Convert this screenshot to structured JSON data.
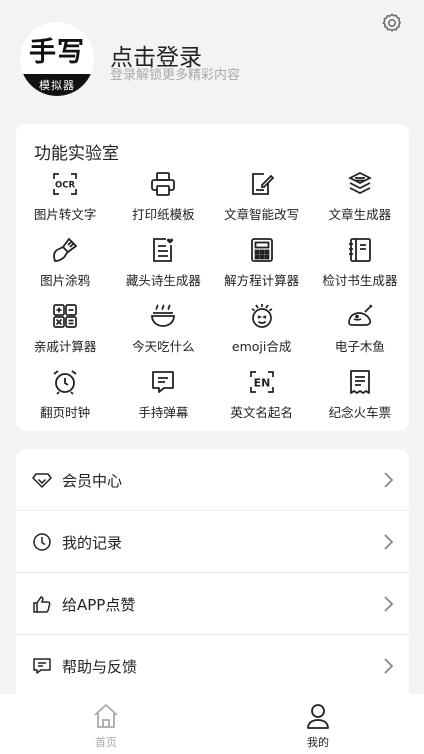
{
  "profile": {
    "logo_main": "手写",
    "logo_sub": "模拟器",
    "login_title": "点击登录",
    "login_subtitle": "登录解锁更多精彩内容"
  },
  "lab": {
    "title": "功能实验室",
    "tools": [
      {
        "label": "图片转文字",
        "icon": "ocr-icon"
      },
      {
        "label": "打印纸模板",
        "icon": "printer-icon"
      },
      {
        "label": "文章智能改写",
        "icon": "edit-doc-icon"
      },
      {
        "label": "文章生成器",
        "icon": "doc-stack-icon"
      },
      {
        "label": "图片涂鸦",
        "icon": "brush-icon"
      },
      {
        "label": "藏头诗生成器",
        "icon": "poem-doc-icon"
      },
      {
        "label": "解方程计算器",
        "icon": "calculator-icon"
      },
      {
        "label": "检讨书生成器",
        "icon": "notebook-icon"
      },
      {
        "label": "亲戚计算器",
        "icon": "relative-calc-icon"
      },
      {
        "label": "今天吃什么",
        "icon": "bowl-icon"
      },
      {
        "label": "emoji合成",
        "icon": "emoji-icon"
      },
      {
        "label": "电子木鱼",
        "icon": "wooden-fish-icon"
      },
      {
        "label": "翻页时钟",
        "icon": "alarm-clock-icon"
      },
      {
        "label": "手持弹幕",
        "icon": "chat-bubble-icon"
      },
      {
        "label": "英文名起名",
        "icon": "en-icon"
      },
      {
        "label": "纪念火车票",
        "icon": "ticket-icon"
      }
    ]
  },
  "menu": {
    "items": [
      {
        "label": "会员中心",
        "icon": "diamond-icon"
      },
      {
        "label": "我的记录",
        "icon": "clock-icon"
      },
      {
        "label": "给APP点赞",
        "icon": "thumbs-up-icon"
      },
      {
        "label": "帮助与反馈",
        "icon": "feedback-icon"
      }
    ]
  },
  "tabbar": {
    "home": "首页",
    "mine": "我的",
    "active_color": "#222222",
    "inactive_color": "#aaaaaa"
  }
}
